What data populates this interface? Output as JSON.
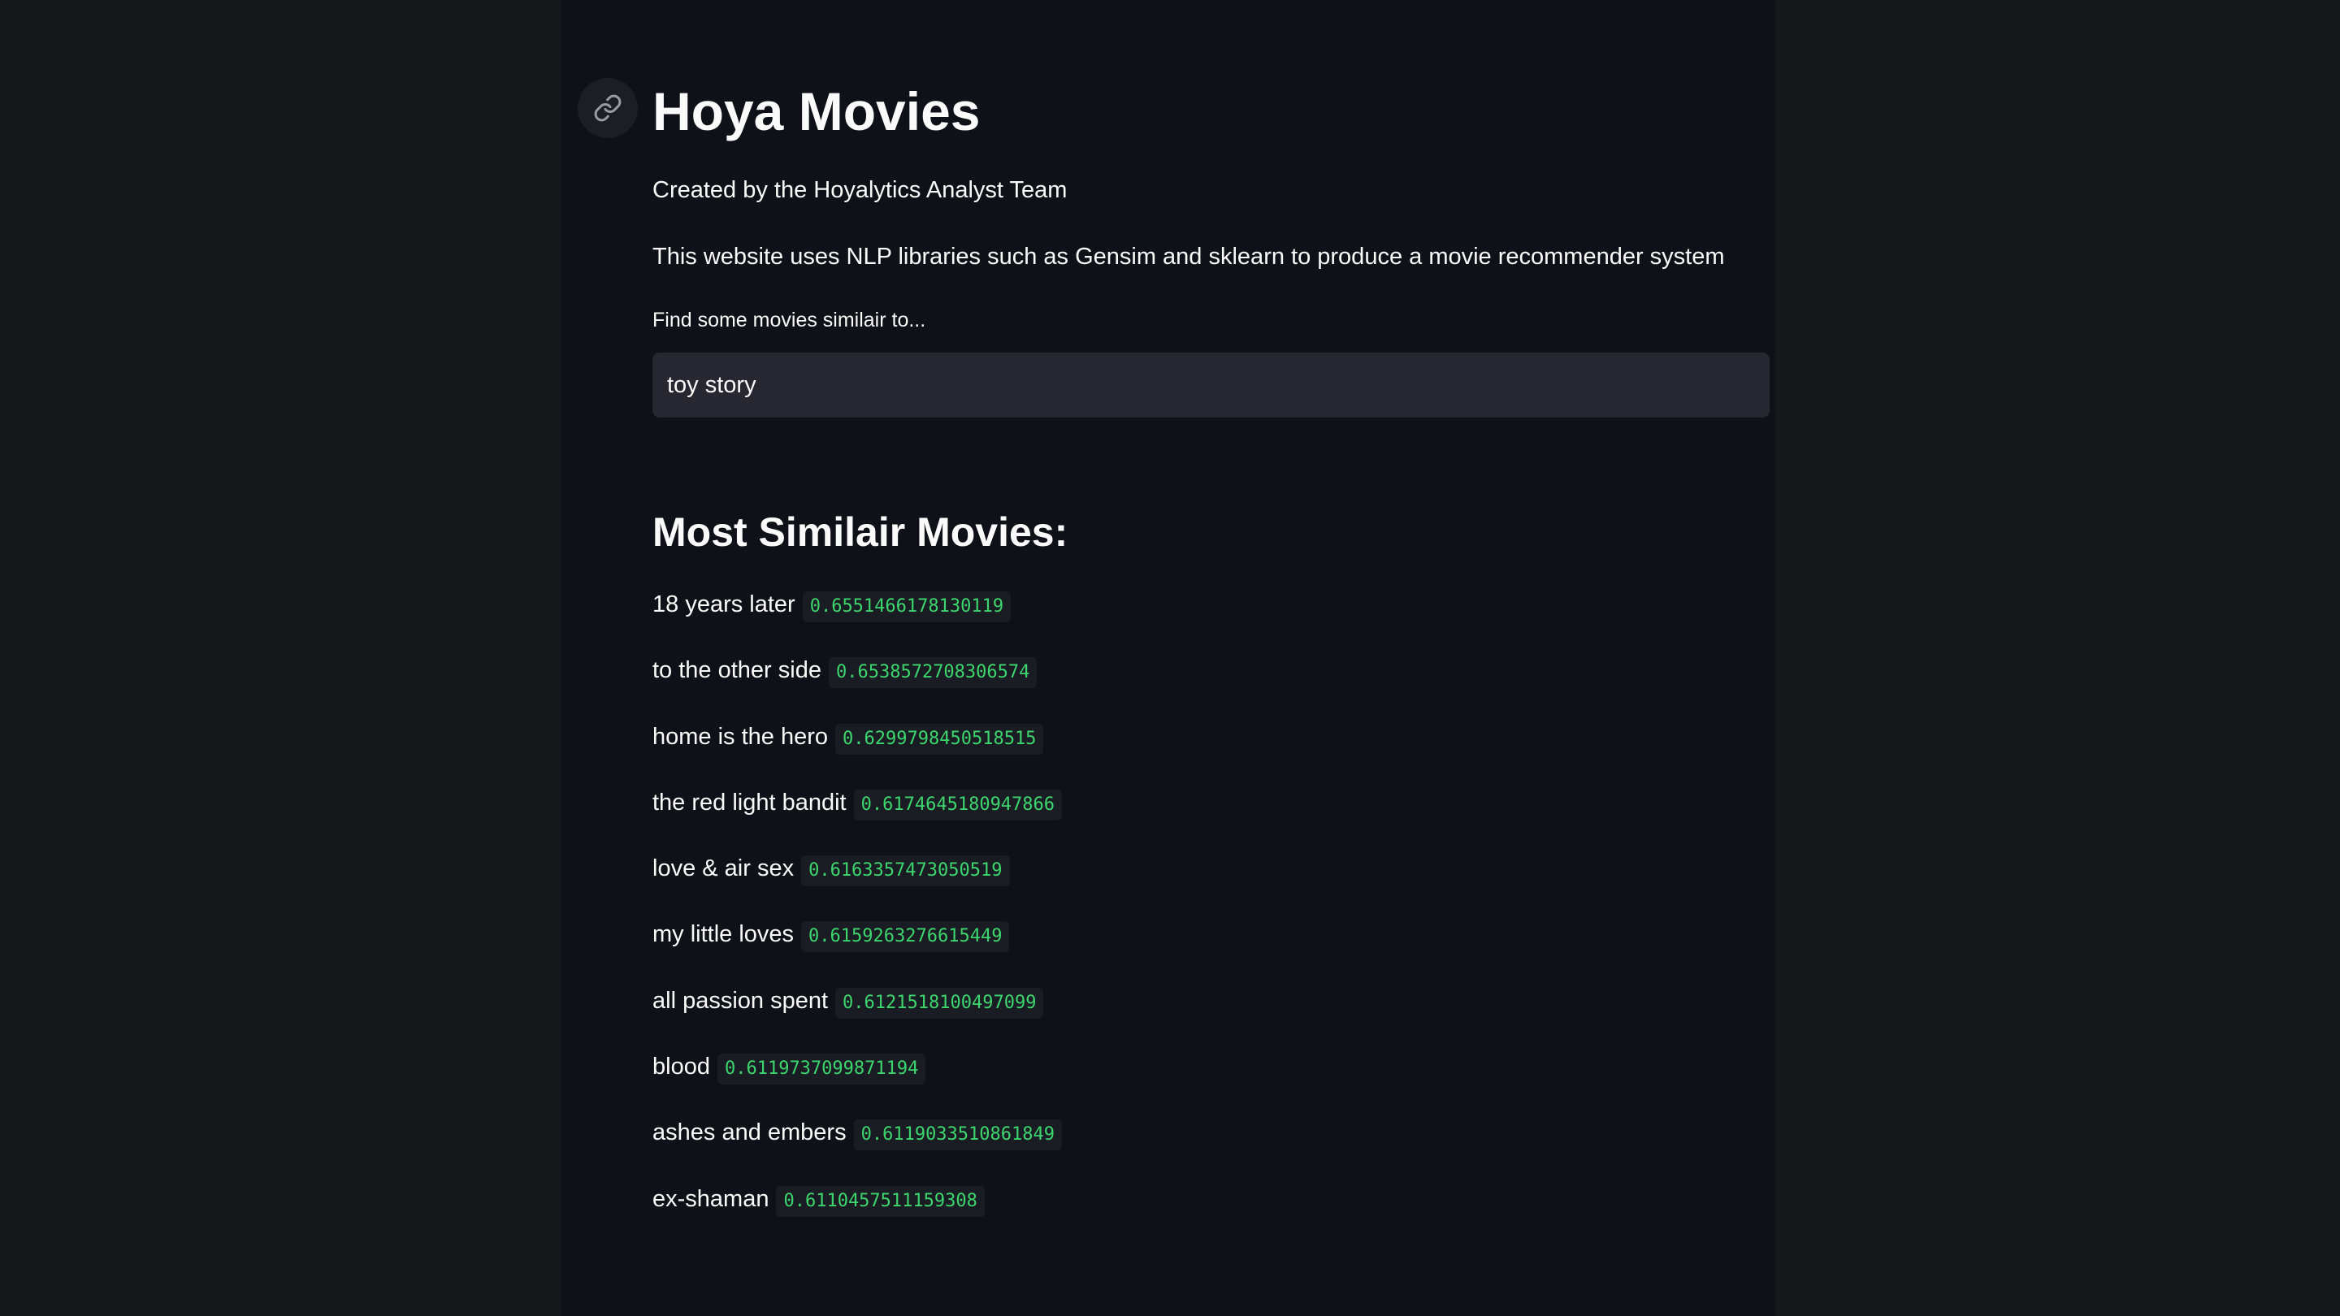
{
  "header": {
    "title": "Hoya Movies",
    "subtitle": "Created by the Hoyalytics Analyst Team",
    "description": "This website uses NLP libraries such as Gensim and sklearn to produce a movie recommender system"
  },
  "search": {
    "label": "Find some movies similair to...",
    "value": "toy story"
  },
  "results": {
    "heading": "Most Similair Movies:",
    "items": [
      {
        "title": "18 years later",
        "score": "0.6551466178130119"
      },
      {
        "title": "to the other side",
        "score": "0.6538572708306574"
      },
      {
        "title": "home is the hero",
        "score": "0.6299798450518515"
      },
      {
        "title": "the red light bandit",
        "score": "0.6174645180947866"
      },
      {
        "title": "love & air sex",
        "score": "0.6163357473050519"
      },
      {
        "title": "my little loves",
        "score": "0.6159263276615449"
      },
      {
        "title": "all passion spent",
        "score": "0.6121518100497099"
      },
      {
        "title": "blood",
        "score": "0.6119737099871194"
      },
      {
        "title": "ashes and embers",
        "score": "0.6119033510861849"
      },
      {
        "title": "ex-shaman",
        "score": "0.6110457511159308"
      }
    ]
  },
  "icons": {
    "anchor": "link-icon"
  },
  "colors": {
    "background": "#0e1117",
    "side_background": "#161719",
    "input_background": "#262730",
    "score_text": "#3dd56d",
    "text": "#fafafa"
  }
}
